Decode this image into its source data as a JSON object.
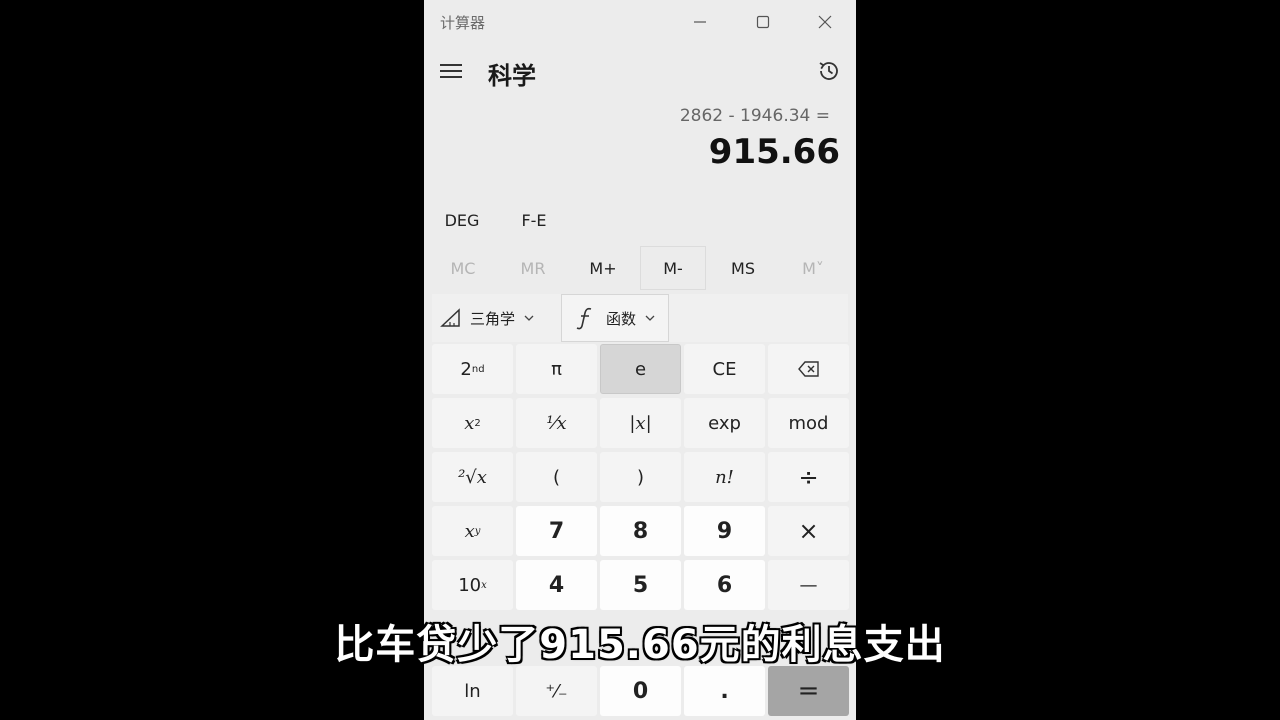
{
  "window": {
    "title": "计算器"
  },
  "header": {
    "mode": "科学"
  },
  "display": {
    "expression": "2862 - 1946.34 =",
    "result": "915.66"
  },
  "modes": {
    "angle": "DEG",
    "notation": "F-E"
  },
  "memory": {
    "mc": "MC",
    "mr": "MR",
    "mplus": "M+",
    "mminus": "M-",
    "ms": "MS",
    "mlist": "M˅"
  },
  "functions": {
    "trig": "三角学",
    "func": "函数"
  },
  "keys": {
    "second": "2",
    "second_sup": "nd",
    "pi": "π",
    "e": "e",
    "ce": "CE",
    "square": "x",
    "square_sup": "2",
    "reciprocal": "¹⁄x",
    "abs": "|x|",
    "exp": "exp",
    "mod": "mod",
    "root": "²√x",
    "lparen": "(",
    "rparen": ")",
    "factorial": "n!",
    "divide": "÷",
    "power": "x",
    "power_sup": "y",
    "seven": "7",
    "eight": "8",
    "nine": "9",
    "multiply": "×",
    "tenpow": "10",
    "tenpow_sup": "x",
    "four": "4",
    "five": "5",
    "six": "6",
    "minus": "—",
    "ln": "ln",
    "negate": "⁺⁄₋",
    "zero": "0",
    "decimal": ".",
    "equals": "="
  },
  "subtitle": "比车贷少了915.66元的利息支出"
}
